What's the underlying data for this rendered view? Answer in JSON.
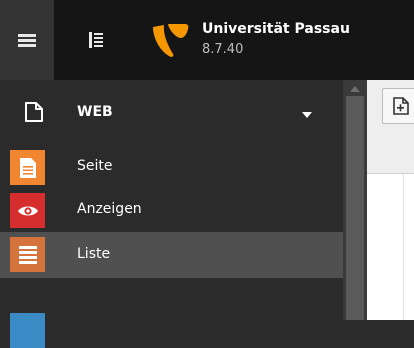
{
  "topbar": {
    "menu_icon": "hamburger-icon",
    "tree_icon": "page-tree-toggle-icon",
    "logo_icon": "typo3-logo-icon",
    "site_name": "Universität Passau",
    "version": "8.7.40"
  },
  "module_menu": {
    "group": {
      "icon": "document-icon",
      "label": "WEB",
      "caret_icon": "caret-down-icon"
    },
    "items": [
      {
        "label": "Seite",
        "icon": "page-module-icon",
        "color": "#f08630",
        "active": false
      },
      {
        "label": "Anzeigen",
        "icon": "eye-icon",
        "color": "#d62e2e",
        "active": false
      },
      {
        "label": "Liste",
        "icon": "list-icon",
        "color": "#d4743c",
        "active": true
      },
      {
        "label": "",
        "icon": "module-icon",
        "color": "#3a8ac6",
        "active": false
      }
    ]
  },
  "content": {
    "new_button_icon": "new-record-icon"
  },
  "colors": {
    "topbar_bg": "#151515",
    "menu_bg": "#2b2b2b",
    "active_item_bg": "#505050"
  }
}
